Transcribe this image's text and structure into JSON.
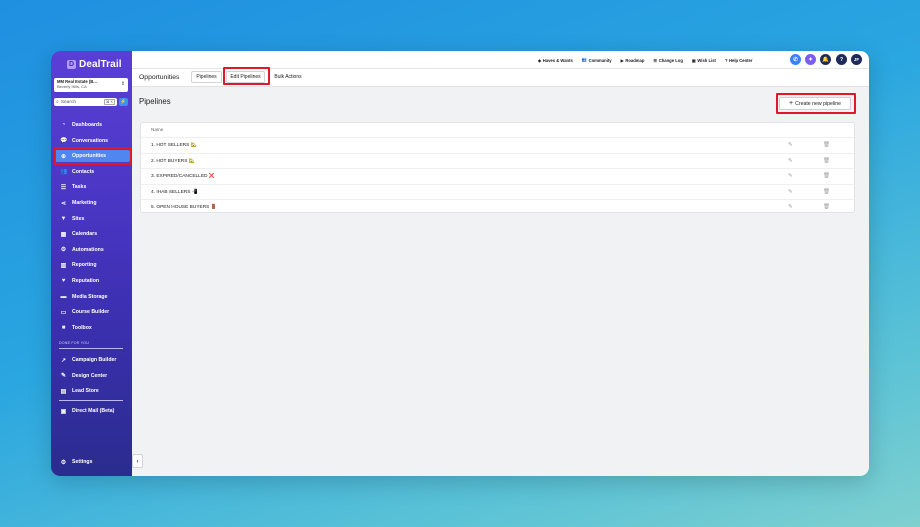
{
  "brand": {
    "name": "DealTrail"
  },
  "account": {
    "name": "MM Real Estate (B...",
    "location": "Beverly Hills, CA"
  },
  "search": {
    "label": "Search",
    "shortcut": "⌘ K"
  },
  "sidebar": {
    "items": [
      {
        "label": "Dashboards",
        "icon": "gauge-icon",
        "glyph": "◔"
      },
      {
        "label": "Conversations",
        "icon": "chat-icon",
        "glyph": "💬"
      },
      {
        "label": "Opportunities",
        "icon": "opportunity-icon",
        "glyph": "⊕"
      },
      {
        "label": "Contacts",
        "icon": "contacts-icon",
        "glyph": "👥"
      },
      {
        "label": "Tasks",
        "icon": "tasks-icon",
        "glyph": "☰"
      },
      {
        "label": "Marketing",
        "icon": "share-icon",
        "glyph": "⋖"
      },
      {
        "label": "Sites",
        "icon": "filter-icon",
        "glyph": "▼"
      },
      {
        "label": "Calendars",
        "icon": "calendar-icon",
        "glyph": "▦"
      },
      {
        "label": "Automations",
        "icon": "gears-icon",
        "glyph": "⚙"
      },
      {
        "label": "Reporting",
        "icon": "chart-icon",
        "glyph": "▥"
      },
      {
        "label": "Reputation",
        "icon": "heart-icon",
        "glyph": "♥"
      },
      {
        "label": "Media Storage",
        "icon": "folder-icon",
        "glyph": "▬"
      },
      {
        "label": "Course Builder",
        "icon": "course-icon",
        "glyph": "▭"
      },
      {
        "label": "Toolbox",
        "icon": "toolbox-icon",
        "glyph": "■"
      }
    ],
    "section_label": "DONE FOR YOU",
    "section_items": [
      {
        "label": "Campaign Builder",
        "icon": "campaign-icon",
        "glyph": "↗"
      },
      {
        "label": "Design Center",
        "icon": "brush-icon",
        "glyph": "✎"
      },
      {
        "label": "Lead Store",
        "icon": "store-icon",
        "glyph": "▤"
      }
    ],
    "extra_items": [
      {
        "label": "Direct Mail (Beta)",
        "icon": "mail-icon",
        "glyph": "▣"
      }
    ],
    "settings": {
      "label": "Settings",
      "icon": "gear-icon",
      "glyph": "⚙"
    }
  },
  "header": {
    "links": [
      {
        "label": "Haves & Wants",
        "glyph": "◆"
      },
      {
        "label": "Community",
        "glyph": "👥"
      },
      {
        "label": "Roadmap",
        "glyph": "▶"
      },
      {
        "label": "Change Log",
        "glyph": "☰"
      },
      {
        "label": "Wish List",
        "glyph": "▣"
      },
      {
        "label": "Help Center",
        "glyph": "?"
      }
    ],
    "user_initials": "JF",
    "colors": {
      "phone": "#3b82f6",
      "ai": "#7c5cf0",
      "bell": "#1e2a5a",
      "help": "#1e2a5a",
      "user": "#1e2a5a"
    }
  },
  "page": {
    "name": "Opportunities",
    "tabs": [
      "Pipelines",
      "Edit Pipelines",
      "Bulk Actions"
    ],
    "active_tab": "Edit Pipelines",
    "title": "Pipelines",
    "create_button": "Create new pipeline"
  },
  "table": {
    "header": "Name",
    "rows": [
      "1. HOT SELLERS 🏡",
      "2. HOT BUYERS 🏡",
      "3. EXPIRED/CANCELLED ❌",
      "4. IHAB SELLERS 📲",
      "5. OPEN HOUSE BUYERS 🚪"
    ]
  },
  "accent": {
    "highlight": "#e0182a",
    "active_nav": "#4f86f0"
  }
}
